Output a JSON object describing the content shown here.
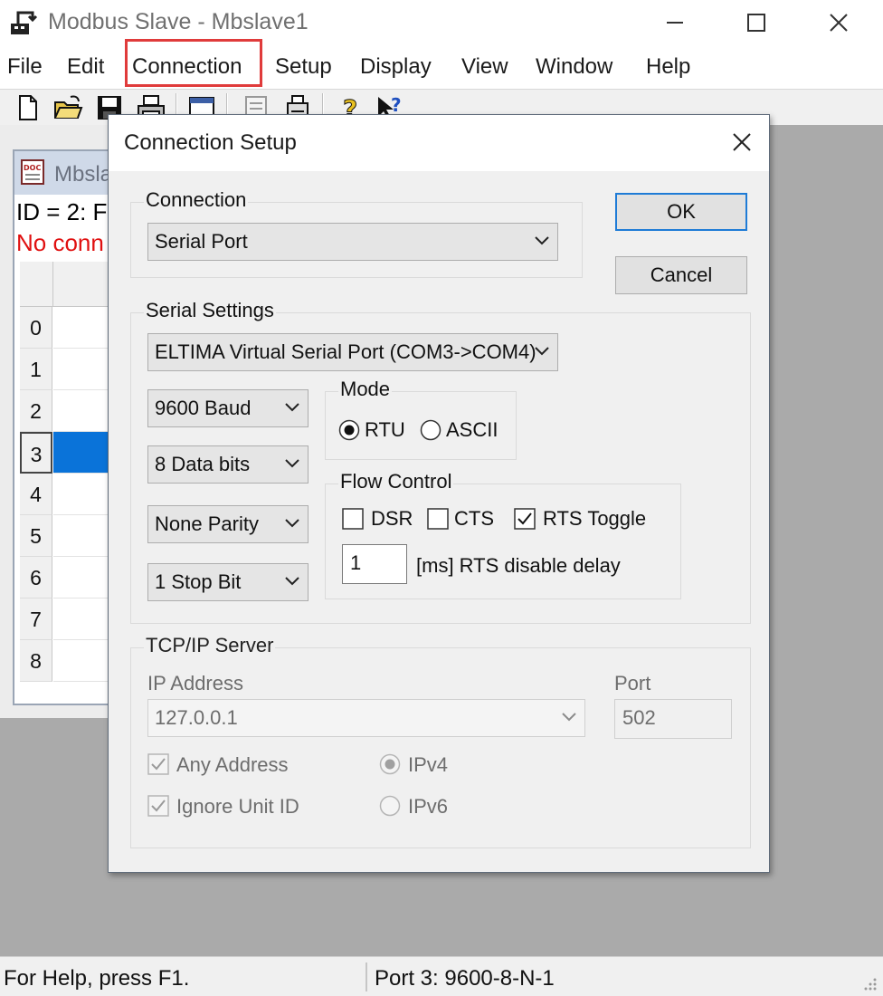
{
  "window": {
    "title": "Modbus Slave - Mbslave1",
    "menu": [
      "File",
      "Edit",
      "Connection",
      "Setup",
      "Display",
      "View",
      "Window",
      "Help"
    ],
    "highlighted_menu": "Connection"
  },
  "toolbar": {
    "icons": [
      "new-file-icon",
      "open-folder-icon",
      "save-icon",
      "print-icon",
      "window-icon",
      "list-icon",
      "printer-icon",
      "help-icon",
      "context-help-icon"
    ]
  },
  "child_window": {
    "title": "Mbsla",
    "id_text": "ID = 2: F",
    "status_text": "No conn",
    "row_numbers": [
      "0",
      "1",
      "2",
      "3",
      "4",
      "5",
      "6",
      "7",
      "8"
    ],
    "selected_row": "3"
  },
  "statusbar": {
    "help": "For Help, press F1.",
    "port": "Port 3: 9600-8-N-1"
  },
  "dialog": {
    "title": "Connection Setup",
    "ok_label": "OK",
    "cancel_label": "Cancel",
    "connection": {
      "group_label": "Connection",
      "type": "Serial Port"
    },
    "serial": {
      "group_label": "Serial Settings",
      "port": "ELTIMA Virtual Serial Port (COM3->COM4)",
      "baud": "9600 Baud",
      "data_bits": "8 Data bits",
      "parity": "None Parity",
      "stop_bits": "1 Stop Bit",
      "mode": {
        "group_label": "Mode",
        "rtu_label": "RTU",
        "ascii_label": "ASCII",
        "selected": "RTU"
      },
      "flow": {
        "group_label": "Flow Control",
        "dsr_label": "DSR",
        "dsr_checked": false,
        "cts_label": "CTS",
        "cts_checked": false,
        "rts_label": "RTS Toggle",
        "rts_checked": true,
        "delay_value": "1",
        "delay_label": "[ms] RTS disable delay"
      }
    },
    "tcp": {
      "group_label": "TCP/IP Server",
      "ip_label": "IP Address",
      "ip_value": "127.0.0.1",
      "port_label": "Port",
      "port_value": "502",
      "any_address_label": "Any Address",
      "any_address_checked": true,
      "ignore_unit_label": "Ignore Unit ID",
      "ignore_unit_checked": true,
      "ipv4_label": "IPv4",
      "ipv6_label": "IPv6",
      "ip_version_selected": "IPv4"
    }
  },
  "colors": {
    "highlight_box": "#e03b3b",
    "selected_row": "#0a73d9",
    "status_error": "#e01010",
    "default_button_border": "#1e7bd6"
  }
}
